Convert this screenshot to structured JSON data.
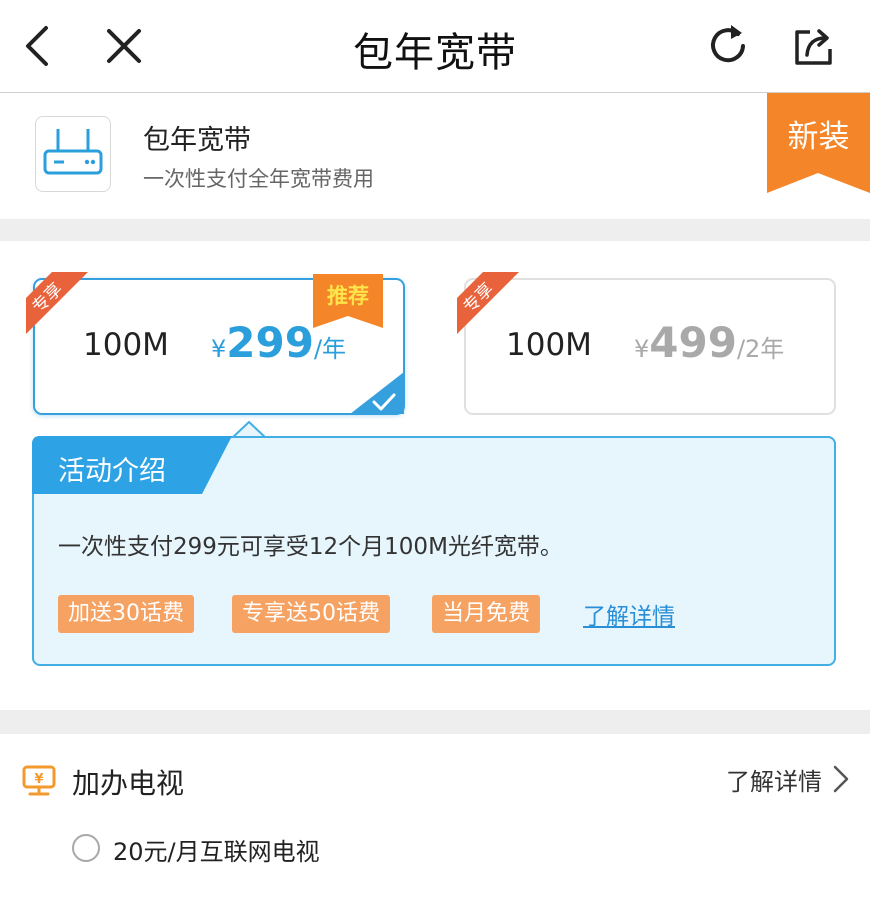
{
  "nav": {
    "title": "包年宽带"
  },
  "product": {
    "title": "包年宽带",
    "subtitle": "一次性支付全年宽带费用",
    "badge": "新装"
  },
  "plans": [
    {
      "tag": "专享",
      "speed": "100M",
      "currency": "¥",
      "price": "299",
      "unit": "/年",
      "recommend": "推荐",
      "selected": true
    },
    {
      "tag": "专享",
      "speed": "100M",
      "currency": "¥",
      "price": "499",
      "unit": "/2年",
      "selected": false
    }
  ],
  "activity": {
    "title": "活动介绍",
    "description": "一次性支付299元可享受12个月100M光纤宽带。",
    "tags": [
      "加送30话费",
      "专享送50话费",
      "当月免费"
    ],
    "detail_link": "了解详情"
  },
  "tv": {
    "title": "加办电视",
    "more": "了解详情",
    "option": "20元/月互联网电视"
  },
  "colors": {
    "accent_blue": "#36a0df",
    "orange": "#f48528",
    "tag_orange": "#f5a262",
    "panel_bg": "#e7f5fd"
  },
  "icons": [
    "back-icon",
    "close-icon",
    "refresh-icon",
    "share-icon",
    "router-icon",
    "tv-icon",
    "chevron-right-icon",
    "checkmark-icon"
  ]
}
